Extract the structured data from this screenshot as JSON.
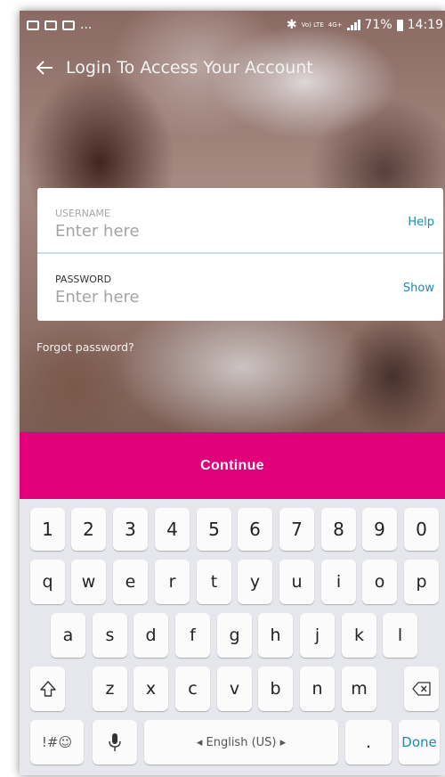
{
  "status_bar": {
    "left_overflow": "...",
    "network": "Vo) LTE",
    "network2": "4G+",
    "battery": "71%",
    "time": "14:19"
  },
  "header": {
    "title": "Login To Access Your Account",
    "back_icon": "arrow-left-icon"
  },
  "form": {
    "username": {
      "label": "USERNAME",
      "placeholder": "Enter here",
      "value": "",
      "action": "Help"
    },
    "password": {
      "label": "PASSWORD",
      "placeholder": "Enter here",
      "value": "",
      "action": "Show"
    },
    "forgot_link": "Forgot password?"
  },
  "continue_button": {
    "label": "Continue"
  },
  "keyboard": {
    "row_numbers": [
      "1",
      "2",
      "3",
      "4",
      "5",
      "6",
      "7",
      "8",
      "9",
      "0"
    ],
    "row1": [
      "q",
      "w",
      "e",
      "r",
      "t",
      "y",
      "u",
      "i",
      "o",
      "p"
    ],
    "row2": [
      "a",
      "s",
      "d",
      "f",
      "g",
      "h",
      "j",
      "k",
      "l"
    ],
    "row3": [
      "z",
      "x",
      "c",
      "v",
      "b",
      "n",
      "m"
    ],
    "symbols_key": "!#☺",
    "space_label": "◂ English (US) ▸",
    "period_key": ".",
    "done_key": "Done"
  },
  "colors": {
    "accent": "#e2007a",
    "link": "#1a8bb5"
  }
}
